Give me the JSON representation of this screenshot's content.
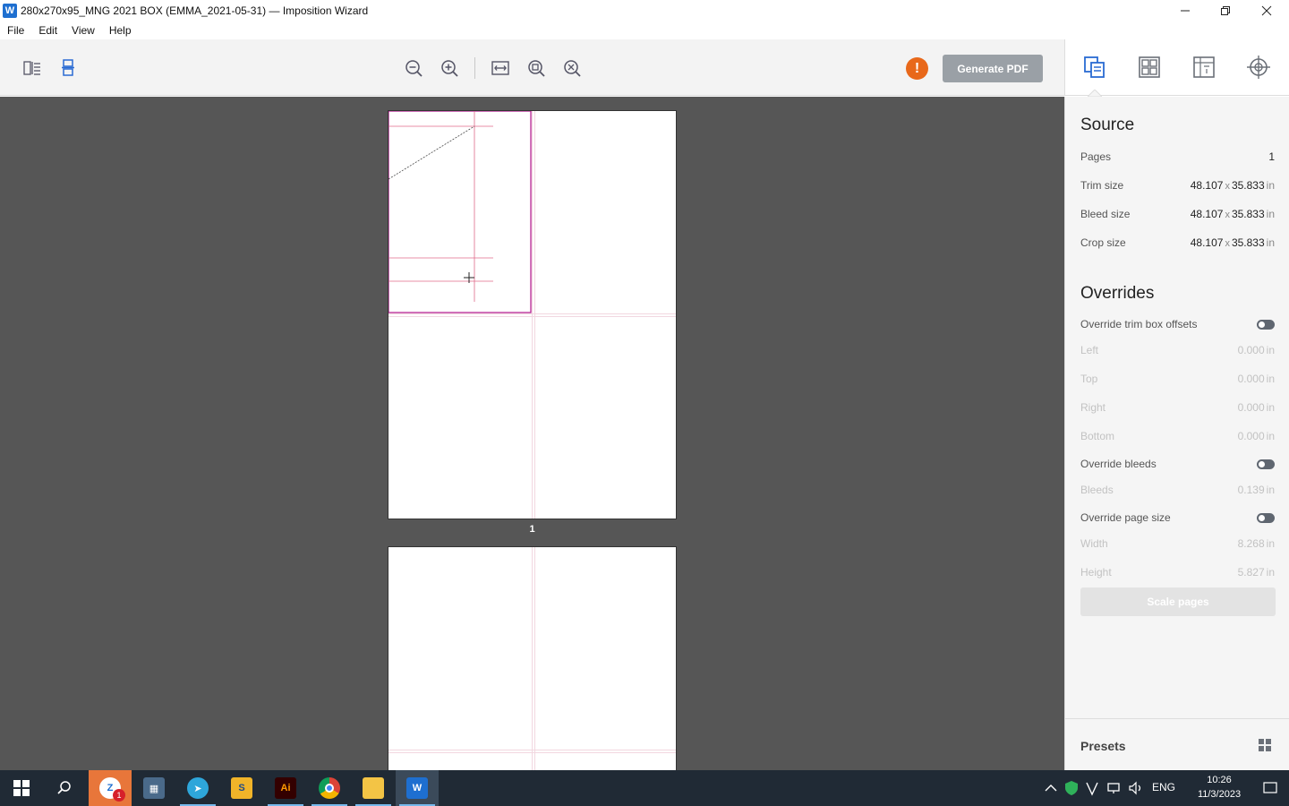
{
  "window": {
    "title": "280x270x95_MNG 2021 BOX (EMMA_2021-05-31) — Imposition Wizard",
    "logo_letter": "W"
  },
  "menu": [
    "File",
    "Edit",
    "View",
    "Help"
  ],
  "toolbar": {
    "icons": [
      "single-page-view-icon",
      "continuous-view-icon",
      "zoom-out-icon",
      "zoom-in-icon",
      "fit-width-icon",
      "actual-size-icon",
      "fit-page-icon"
    ],
    "warning_glyph": "!",
    "generate_label": "Generate PDF",
    "warning_color": "#e8681a"
  },
  "canvas": {
    "sheet1_label": "1",
    "background": "#565656"
  },
  "right_tabs": [
    "source-tab-icon",
    "layout-tab-icon",
    "sheet-tab-icon",
    "marks-tab-icon"
  ],
  "source": {
    "title": "Source",
    "pages_label": "Pages",
    "pages_value": "1",
    "trim_label": "Trim size",
    "trim_w": "48.107",
    "trim_h": "35.833",
    "bleed_label": "Bleed size",
    "bleed_w": "48.107",
    "bleed_h": "35.833",
    "crop_label": "Crop size",
    "crop_w": "48.107",
    "crop_h": "35.833",
    "times": "x",
    "unit": "in"
  },
  "overrides": {
    "title": "Overrides",
    "trim_offsets_label": "Override trim box offsets",
    "left_label": "Left",
    "left_value": "0.000",
    "top_label": "Top",
    "top_value": "0.000",
    "right_label": "Right",
    "right_value": "0.000",
    "bottom_label": "Bottom",
    "bottom_value": "0.000",
    "bleeds_toggle_label": "Override bleeds",
    "bleeds_label": "Bleeds",
    "bleeds_value": "0.139",
    "page_size_label": "Override page size",
    "width_label": "Width",
    "width_value": "8.268",
    "height_label": "Height",
    "height_value": "5.827",
    "unit": "in",
    "scale_button": "Scale pages"
  },
  "presets": {
    "label": "Presets"
  },
  "taskbar": {
    "badge_count": "1",
    "lang": "ENG",
    "time": "10:26",
    "date": "11/3/2023",
    "illustrator_label": "Ai"
  }
}
